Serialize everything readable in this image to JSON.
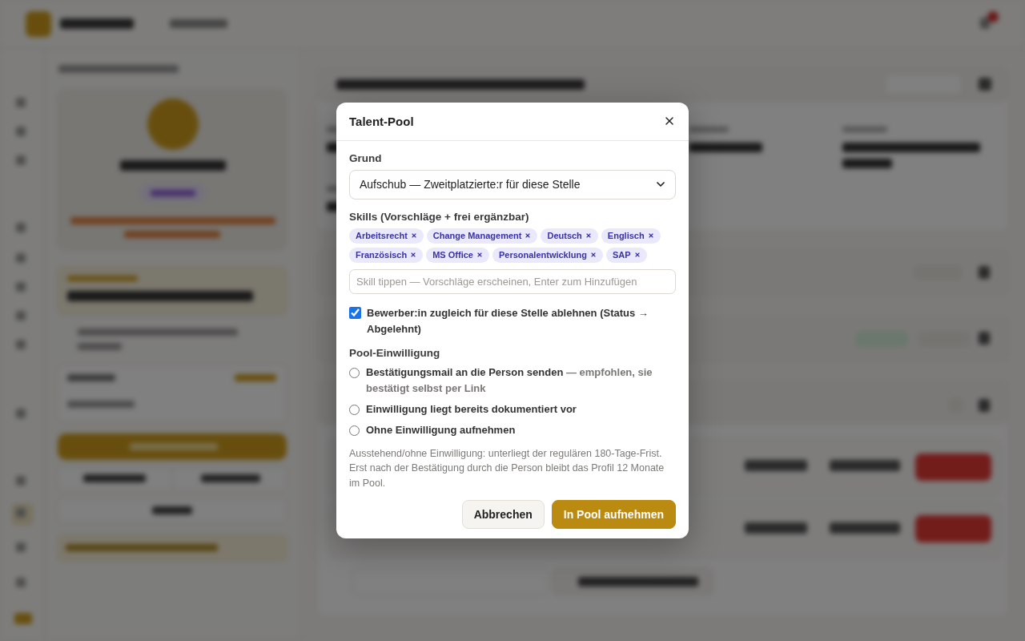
{
  "dialog": {
    "title": "Talent-Pool",
    "reason": {
      "label": "Grund",
      "value": "Aufschub — Zweitplatzierte:r für diese Stelle"
    },
    "skills": {
      "label": "Skills (Vorschläge + frei ergänzbar)",
      "tags": [
        {
          "label": "Arbeitsrecht"
        },
        {
          "label": "Change Management"
        },
        {
          "label": "Deutsch"
        },
        {
          "label": "Englisch"
        },
        {
          "label": "Französisch"
        },
        {
          "label": "MS Office"
        },
        {
          "label": "Personalentwicklung"
        },
        {
          "label": "SAP"
        }
      ],
      "input": {
        "placeholder": "Skill tippen — Vorschläge erscheinen, Enter zum Hinzufügen"
      }
    },
    "reject": {
      "label": "Bewerber:in zugleich für diese Stelle ablehnen (Status → Abgelehnt)",
      "checked": true
    },
    "consent": {
      "label": "Pool-Einwilligung",
      "options": [
        {
          "label": "Bestätigungsmail an die Person senden",
          "hint": "— empfohlen, sie bestätigt selbst per Link",
          "selected": false
        },
        {
          "label": "Einwilligung liegt bereits dokumentiert vor",
          "selected": false
        },
        {
          "label": "Ohne Einwilligung aufnehmen",
          "selected": false
        }
      ]
    },
    "note": "Ausstehend/ohne Einwilligung: unterliegt der regulären 180-Tage-Frist. Erst nach der Bestätigung durch die Person bleibt das Profil 12 Monate im Pool.",
    "buttons": [
      {
        "label": "Abbrechen",
        "kind": "cancel"
      },
      {
        "label": "In Pool aufnehmen",
        "kind": "confirm"
      }
    ]
  }
}
